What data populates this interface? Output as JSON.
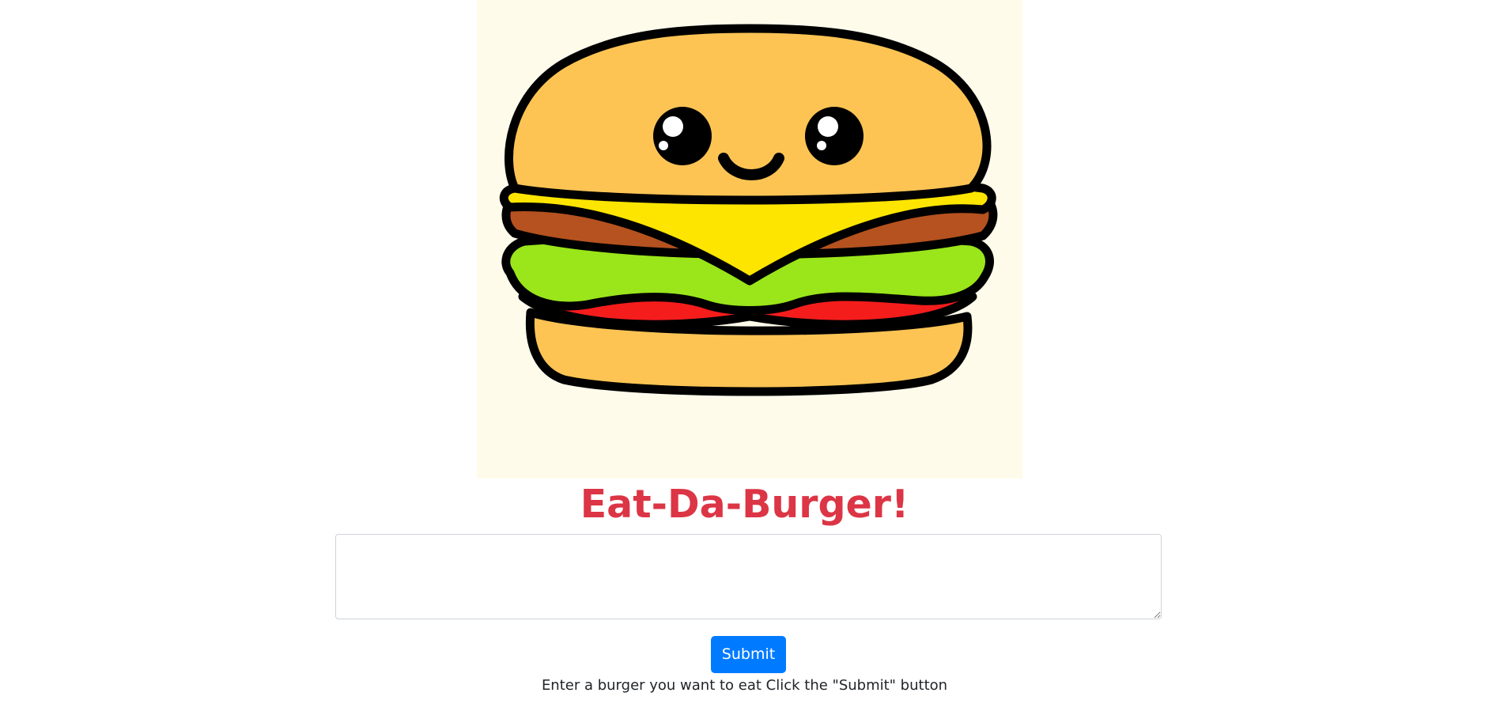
{
  "hero": {
    "image_name": "cartoon-burger-illustration",
    "background_color": "#fffbeb"
  },
  "header": {
    "title": "Eat-Da-Burger!",
    "title_color": "#dc3545"
  },
  "form": {
    "textarea_value": "",
    "submit_label": "Submit",
    "submit_color": "#007bff"
  },
  "footer": {
    "instructions": "Enter a burger you want to eat Click the \"Submit\" button"
  }
}
